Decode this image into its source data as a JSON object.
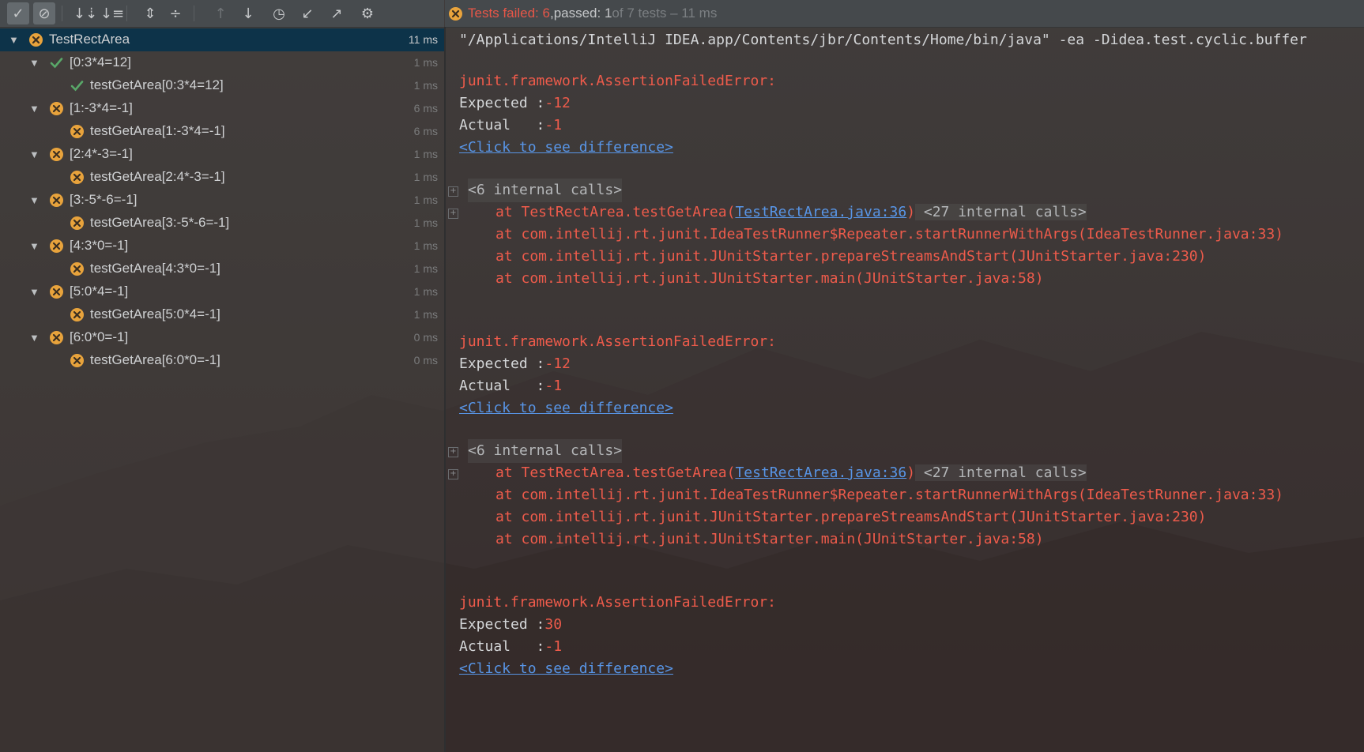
{
  "toolbar": {
    "buttons": [
      {
        "name": "show-passed-button",
        "icon": "check-icon",
        "glyph": "✓",
        "active": true
      },
      {
        "name": "show-ignored-button",
        "icon": "no-entry-icon",
        "glyph": "⊘",
        "active": true
      },
      {
        "name": "sort-alpha-button",
        "icon": "sort-alphabetically-icon",
        "glyph": "↓⇣",
        "active": false
      },
      {
        "name": "sort-duration-button",
        "icon": "sort-by-duration-icon",
        "glyph": "↓≡",
        "active": false
      },
      {
        "name": "expand-all-button",
        "icon": "expand-all-icon",
        "glyph": "⇕",
        "active": false
      },
      {
        "name": "collapse-all-button",
        "icon": "collapse-all-icon",
        "glyph": "÷",
        "active": false
      },
      {
        "name": "prev-failed-button",
        "icon": "arrow-up-icon",
        "glyph": "↑",
        "active": false
      },
      {
        "name": "next-failed-button",
        "icon": "arrow-down-icon",
        "glyph": "↓",
        "active": false
      },
      {
        "name": "test-history-button",
        "icon": "clock-icon",
        "glyph": "◷",
        "active": false
      },
      {
        "name": "import-tests-button",
        "icon": "import-icon",
        "glyph": "↙",
        "active": false
      },
      {
        "name": "export-tests-button",
        "icon": "export-icon",
        "glyph": "↗",
        "active": false
      },
      {
        "name": "settings-button",
        "icon": "gear-icon",
        "glyph": "⚙",
        "active": false
      }
    ]
  },
  "status": {
    "failed_text": "Tests failed: 6",
    "sep": ", ",
    "passed_text": "passed: 1",
    "rest_text": " of 7 tests – 11 ms",
    "icon": "error-circle-icon"
  },
  "colors": {
    "fail": "#e8a33c",
    "pass": "#59a869",
    "error_text": "#ee5b4b",
    "link": "#5895e6",
    "selection": "#0d3349"
  },
  "tree": [
    {
      "label": "TestRectArea",
      "duration": "11 ms",
      "status": "fail",
      "level": 0,
      "expanded": true,
      "selected": true
    },
    {
      "label": "[0:3*4=12]",
      "duration": "1 ms",
      "status": "pass",
      "level": 1,
      "expanded": true
    },
    {
      "label": "testGetArea[0:3*4=12]",
      "duration": "1 ms",
      "status": "pass",
      "level": 2
    },
    {
      "label": "[1:-3*4=-1]",
      "duration": "6 ms",
      "status": "fail",
      "level": 1,
      "expanded": true
    },
    {
      "label": "testGetArea[1:-3*4=-1]",
      "duration": "6 ms",
      "status": "fail",
      "level": 2
    },
    {
      "label": "[2:4*-3=-1]",
      "duration": "1 ms",
      "status": "fail",
      "level": 1,
      "expanded": true
    },
    {
      "label": "testGetArea[2:4*-3=-1]",
      "duration": "1 ms",
      "status": "fail",
      "level": 2
    },
    {
      "label": "[3:-5*-6=-1]",
      "duration": "1 ms",
      "status": "fail",
      "level": 1,
      "expanded": true
    },
    {
      "label": "testGetArea[3:-5*-6=-1]",
      "duration": "1 ms",
      "status": "fail",
      "level": 2
    },
    {
      "label": "[4:3*0=-1]",
      "duration": "1 ms",
      "status": "fail",
      "level": 1,
      "expanded": true
    },
    {
      "label": "testGetArea[4:3*0=-1]",
      "duration": "1 ms",
      "status": "fail",
      "level": 2
    },
    {
      "label": "[5:0*4=-1]",
      "duration": "1 ms",
      "status": "fail",
      "level": 1,
      "expanded": true
    },
    {
      "label": "testGetArea[5:0*4=-1]",
      "duration": "1 ms",
      "status": "fail",
      "level": 2
    },
    {
      "label": "[6:0*0=-1]",
      "duration": "0 ms",
      "status": "fail",
      "level": 1,
      "expanded": true
    },
    {
      "label": "testGetArea[6:0*0=-1]",
      "duration": "0 ms",
      "status": "fail",
      "level": 2
    }
  ],
  "console": {
    "command": "\"/Applications/IntelliJ IDEA.app/Contents/jbr/Contents/Home/bin/java\" -ea -Didea.test.cyclic.buffer",
    "failures": [
      {
        "error": "junit.framework.AssertionFailedError:",
        "expected_label": "Expected :",
        "expected": "-12",
        "actual_label": "Actual   :",
        "actual": "-1",
        "diff_link": "<Click to see difference>",
        "internal": "<6 internal calls>",
        "frames": [
          {
            "pre": "at TestRectArea.testGetArea(",
            "link": "TestRectArea.java:36",
            "post": ")",
            "suffix": " <27 internal calls>"
          },
          {
            "pre": "at com.intellij.rt.junit.IdeaTestRunner$Repeater.startRunnerWithArgs(IdeaTestRunner.java:33)"
          },
          {
            "pre": "at com.intellij.rt.junit.JUnitStarter.prepareStreamsAndStart(JUnitStarter.java:230)"
          },
          {
            "pre": "at com.intellij.rt.junit.JUnitStarter.main(JUnitStarter.java:58)"
          }
        ]
      },
      {
        "error": "junit.framework.AssertionFailedError:",
        "expected_label": "Expected :",
        "expected": "-12",
        "actual_label": "Actual   :",
        "actual": "-1",
        "diff_link": "<Click to see difference>",
        "internal": "<6 internal calls>",
        "frames": [
          {
            "pre": "at TestRectArea.testGetArea(",
            "link": "TestRectArea.java:36",
            "post": ")",
            "suffix": " <27 internal calls>"
          },
          {
            "pre": "at com.intellij.rt.junit.IdeaTestRunner$Repeater.startRunnerWithArgs(IdeaTestRunner.java:33)"
          },
          {
            "pre": "at com.intellij.rt.junit.JUnitStarter.prepareStreamsAndStart(JUnitStarter.java:230)"
          },
          {
            "pre": "at com.intellij.rt.junit.JUnitStarter.main(JUnitStarter.java:58)"
          }
        ]
      },
      {
        "error": "junit.framework.AssertionFailedError:",
        "expected_label": "Expected :",
        "expected": "30",
        "actual_label": "Actual   :",
        "actual": "-1",
        "diff_link": "<Click to see difference>"
      }
    ]
  }
}
